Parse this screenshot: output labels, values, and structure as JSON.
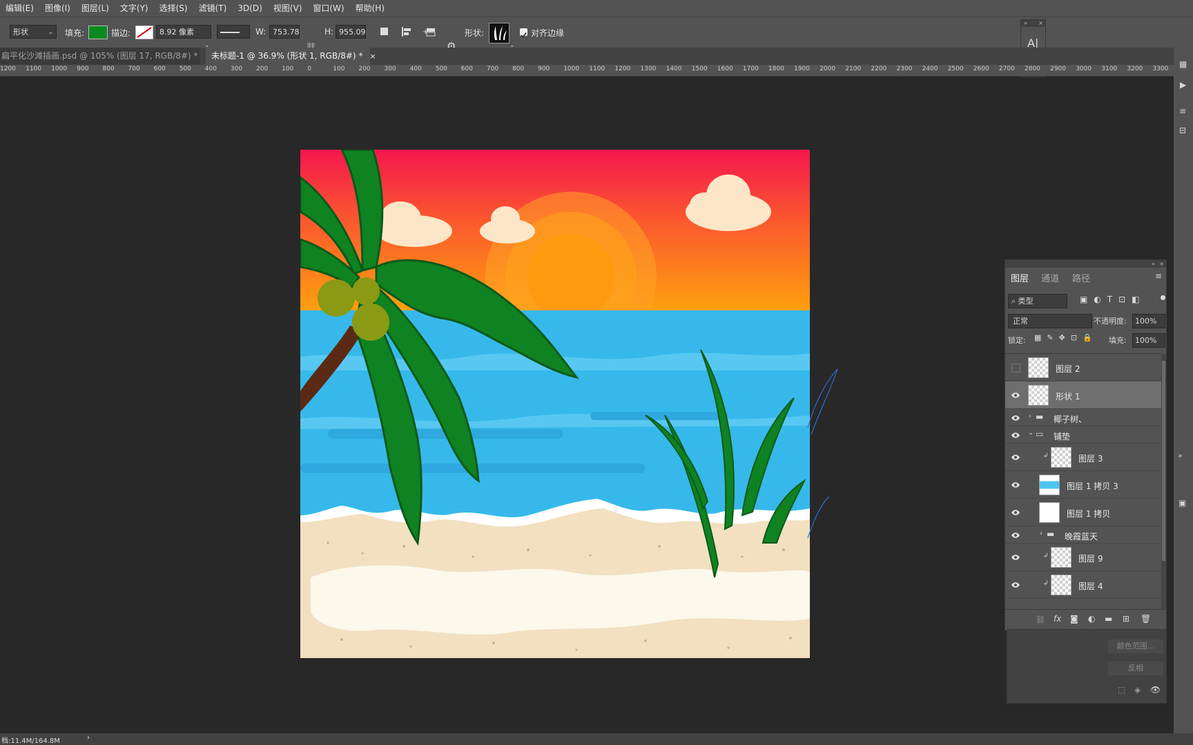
{
  "menu": [
    "编辑(E)",
    "图像(I)",
    "图层(L)",
    "文字(Y)",
    "选择(S)",
    "滤镜(T)",
    "3D(D)",
    "视图(V)",
    "窗口(W)",
    "帮助(H)"
  ],
  "options": {
    "tool_mode": "形状",
    "fill_label": "填充:",
    "fill_color": "#0a8a1e",
    "stroke_label": "描边:",
    "stroke_width": "8.92 像素",
    "w_label": "W:",
    "w_value": "753.78",
    "h_label": "H:",
    "h_value": "955.09",
    "shape_label": "形状:",
    "align_edges": "对齐边缘"
  },
  "tabs": [
    {
      "label": "扁平化沙滩插画.psd @ 105% (图层 17, RGB/8#) *",
      "active": false
    },
    {
      "label": "未标题-1 @ 36.9% (形状 1, RGB/8#) *",
      "active": true
    }
  ],
  "ruler_ticks": [
    "1200",
    "1100",
    "1000",
    "900",
    "800",
    "700",
    "600",
    "500",
    "400",
    "300",
    "200",
    "100",
    "0",
    "100",
    "200",
    "300",
    "400",
    "500",
    "600",
    "700",
    "800",
    "900",
    "1000",
    "1100",
    "1200",
    "1300",
    "1400",
    "1500",
    "1600",
    "1700",
    "1800",
    "1900",
    "2000",
    "2100",
    "2200",
    "2300",
    "2400",
    "2500",
    "2600",
    "2700",
    "2800",
    "2900",
    "3000",
    "3100",
    "3200",
    "3300"
  ],
  "layers_panel": {
    "tabs": [
      "图层",
      "通道",
      "路径"
    ],
    "filter_kind": "类型",
    "blend_mode": "正常",
    "opacity_label": "不透明度:",
    "opacity_value": "100%",
    "lock_label": "锁定:",
    "fill_label": "填充:",
    "fill_value": "100%",
    "layers": [
      {
        "name": "图层 2",
        "visible": false,
        "type": "layer"
      },
      {
        "name": "形状 1",
        "visible": true,
        "type": "shape",
        "selected": true
      },
      {
        "name": "椰子树、",
        "visible": true,
        "type": "group"
      },
      {
        "name": "铺垫",
        "visible": true,
        "type": "group-open"
      },
      {
        "name": "图层 3",
        "visible": true,
        "type": "layer"
      },
      {
        "name": "图层 1 拷贝 3",
        "visible": true,
        "type": "layer"
      },
      {
        "name": "图层 1 拷贝",
        "visible": true,
        "type": "layer"
      },
      {
        "name": "晚霞蓝天",
        "visible": true,
        "type": "group"
      },
      {
        "name": "图层 9",
        "visible": true,
        "type": "layer"
      },
      {
        "name": "图层 4",
        "visible": true,
        "type": "layer"
      }
    ]
  },
  "under_panel": {
    "color_range": "颜色范围...",
    "invert": "反相"
  },
  "status": {
    "doc_size": "档:11.4M/164.8M"
  },
  "icons": [
    "shape-tool-icon",
    "link-icon",
    "path-ops-icon",
    "gear-icon",
    "character-icon",
    "paragraph-icon",
    "eye-icon",
    "folder-icon",
    "trash-icon",
    "fx-icon",
    "mask-icon",
    "new-layer-icon"
  ]
}
